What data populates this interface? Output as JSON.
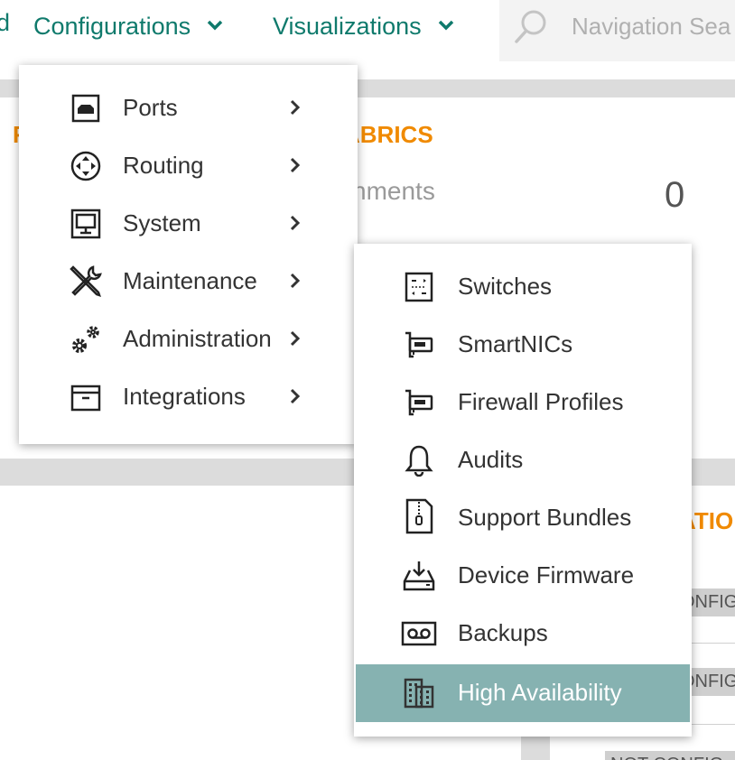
{
  "topnav": {
    "partial_left": "d",
    "items": [
      {
        "label": "Configurations",
        "icon": "chevron-down-icon"
      },
      {
        "label": "Visualizations",
        "icon": "chevron-down-icon"
      }
    ],
    "search": {
      "placeholder": "Navigation Sea",
      "icon": "search-icon"
    }
  },
  "background": {
    "card_title_left": "F",
    "card_title_right": "ABRICS",
    "card_row_label": "nments",
    "card_row_count": "0",
    "lower_title": "ATIO",
    "chip_1": "ONFIG",
    "chip_2": "ONFIG",
    "chip_3": "NOT CONFIG"
  },
  "config_menu": {
    "items": [
      {
        "label": "Ports",
        "icon": "port-icon"
      },
      {
        "label": "Routing",
        "icon": "routing-icon"
      },
      {
        "label": "System",
        "icon": "monitor-icon"
      },
      {
        "label": "Maintenance",
        "icon": "wrench-screwdriver-icon"
      },
      {
        "label": "Administration",
        "icon": "gears-icon"
      },
      {
        "label": "Integrations",
        "icon": "archive-box-icon"
      }
    ]
  },
  "maintenance_submenu": {
    "items": [
      {
        "label": "Switches",
        "icon": "switch-icon"
      },
      {
        "label": "SmartNICs",
        "icon": "nic-card-icon"
      },
      {
        "label": "Firewall Profiles",
        "icon": "nic-card-icon"
      },
      {
        "label": "Audits",
        "icon": "bell-icon"
      },
      {
        "label": "Support Bundles",
        "icon": "zip-file-icon"
      },
      {
        "label": "Device Firmware",
        "icon": "download-tray-icon"
      },
      {
        "label": "Backups",
        "icon": "tape-icon"
      },
      {
        "label": "High Availability",
        "icon": "buildings-icon",
        "active": true
      }
    ],
    "active_color": "#86b2b1"
  },
  "colors": {
    "nav_teal": "#0f7a6c",
    "orange": "#f08a00"
  }
}
